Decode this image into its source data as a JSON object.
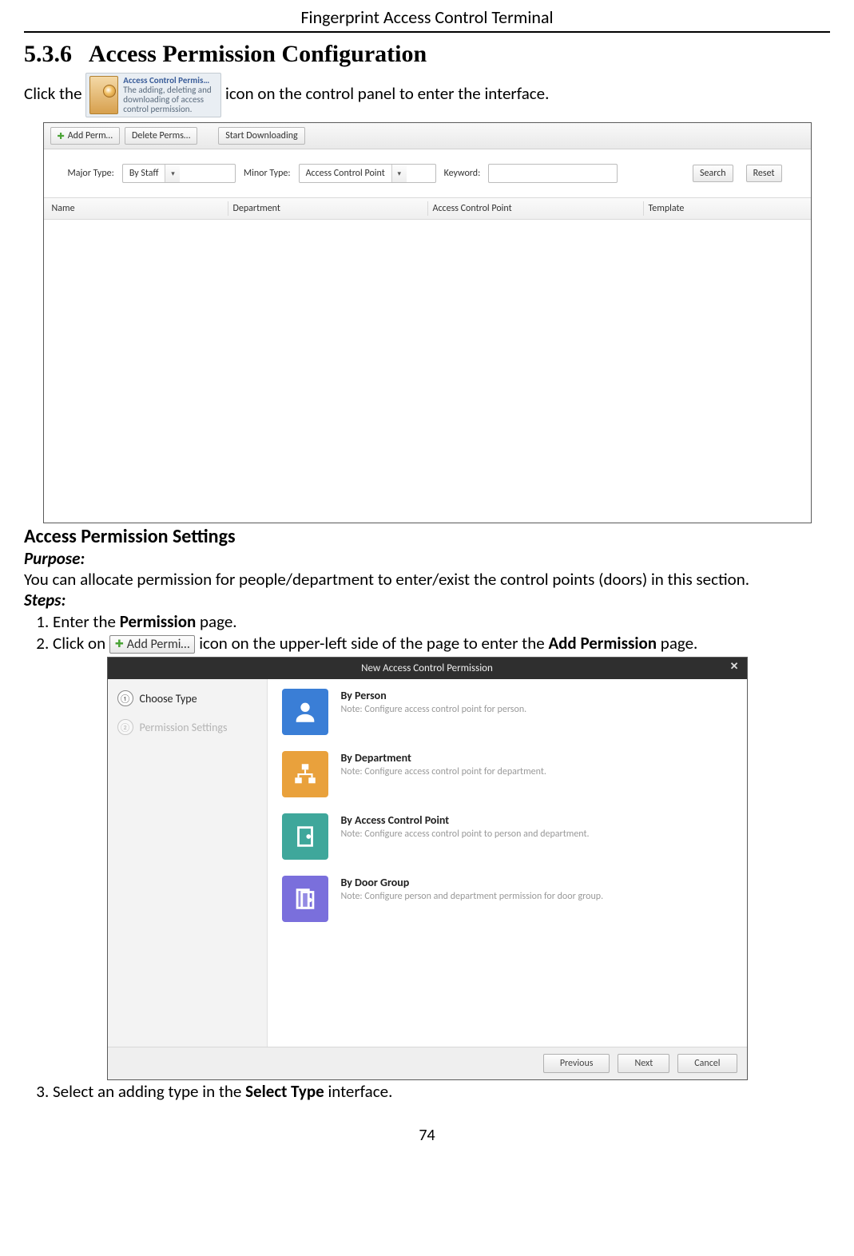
{
  "header": {
    "title": "Fingerprint Access Control Terminal"
  },
  "section": {
    "number": "5.3.6",
    "title": "Access Permission Configuration"
  },
  "intro": {
    "pre": "Click the ",
    "post": " icon on the control panel to enter the interface."
  },
  "tile": {
    "title": "Access Control Permis…",
    "desc": "The adding, deleting and downloading of access control permission."
  },
  "toolbar": {
    "add": "Add Perm…",
    "delete": "Delete Perms…",
    "download": "Start Downloading"
  },
  "filter": {
    "majorLabel": "Major Type:",
    "majorValue": "By Staff",
    "minorLabel": "Minor Type:",
    "minorValue": "Access Control Point",
    "keywordLabel": "Keyword:",
    "keywordValue": "",
    "searchBtn": "Search",
    "resetBtn": "Reset"
  },
  "columns": {
    "c1": "Name",
    "c2": "Department",
    "c3": "Access Control Point",
    "c4": "Template"
  },
  "settings": {
    "heading": "Access Permission Settings",
    "purposeLabel": "Purpose:",
    "purposeText": "You can allocate permission for people/department to enter/exist the control points (doors) in this section.",
    "stepsLabel": "Steps:"
  },
  "steps": {
    "s1_a": "Enter the ",
    "s1_bold": "Permission",
    "s1_b": " page.",
    "s2_a": "Click on ",
    "s2_btn": "Add Permi…",
    "s2_b": " icon on the upper-left side of the page to enter the ",
    "s2_bold": "Add Permission",
    "s2_c": " page.",
    "s3_a": "Select an adding type in the ",
    "s3_bold": "Select Type",
    "s3_b": " interface."
  },
  "dialog": {
    "title": "New Access Control Permission",
    "step1": "Choose Type",
    "step2": "Permission Settings",
    "opts": {
      "p_title": "By Person",
      "p_note": "Note: Configure access control point for person.",
      "d_title": "By Department",
      "d_note": "Note: Configure access control point for department.",
      "a_title": "By Access Control Point",
      "a_note": "Note: Configure access control point to person and department.",
      "g_title": "By Door Group",
      "g_note": "Note: Configure person and department permission for door group."
    },
    "prev": "Previous",
    "next": "Next",
    "cancel": "Cancel"
  },
  "pageNumber": "74"
}
